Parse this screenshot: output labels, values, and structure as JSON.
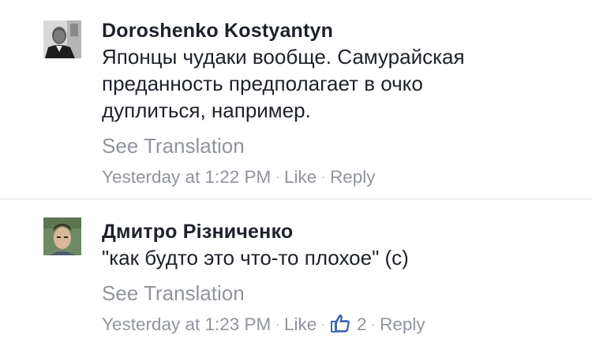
{
  "comments": [
    {
      "author": "Doroshenko Kostyantyn",
      "lines": [
        "Японцы чудаки вообще. Самурайская",
        "преданность предполагает в очко",
        "дуплиться, например."
      ],
      "see_translation": "See Translation",
      "timestamp": "Yesterday at 1:22 PM",
      "like_label": "Like",
      "reply_label": "Reply"
    },
    {
      "author": "Дмитро Різниченко",
      "lines": [
        "\"как будто это что-то плохое\" (с)"
      ],
      "see_translation": "See Translation",
      "timestamp": "Yesterday at 1:23 PM",
      "like_label": "Like",
      "like_count": "2",
      "reply_label": "Reply"
    }
  ],
  "separator_glyph": "·",
  "icons": {
    "like_reaction": "thumbs-up-icon"
  },
  "colors": {
    "text": "#1d2129",
    "muted": "#90949c",
    "like_blue": "#4267b2",
    "divider": "#dddfe2"
  }
}
